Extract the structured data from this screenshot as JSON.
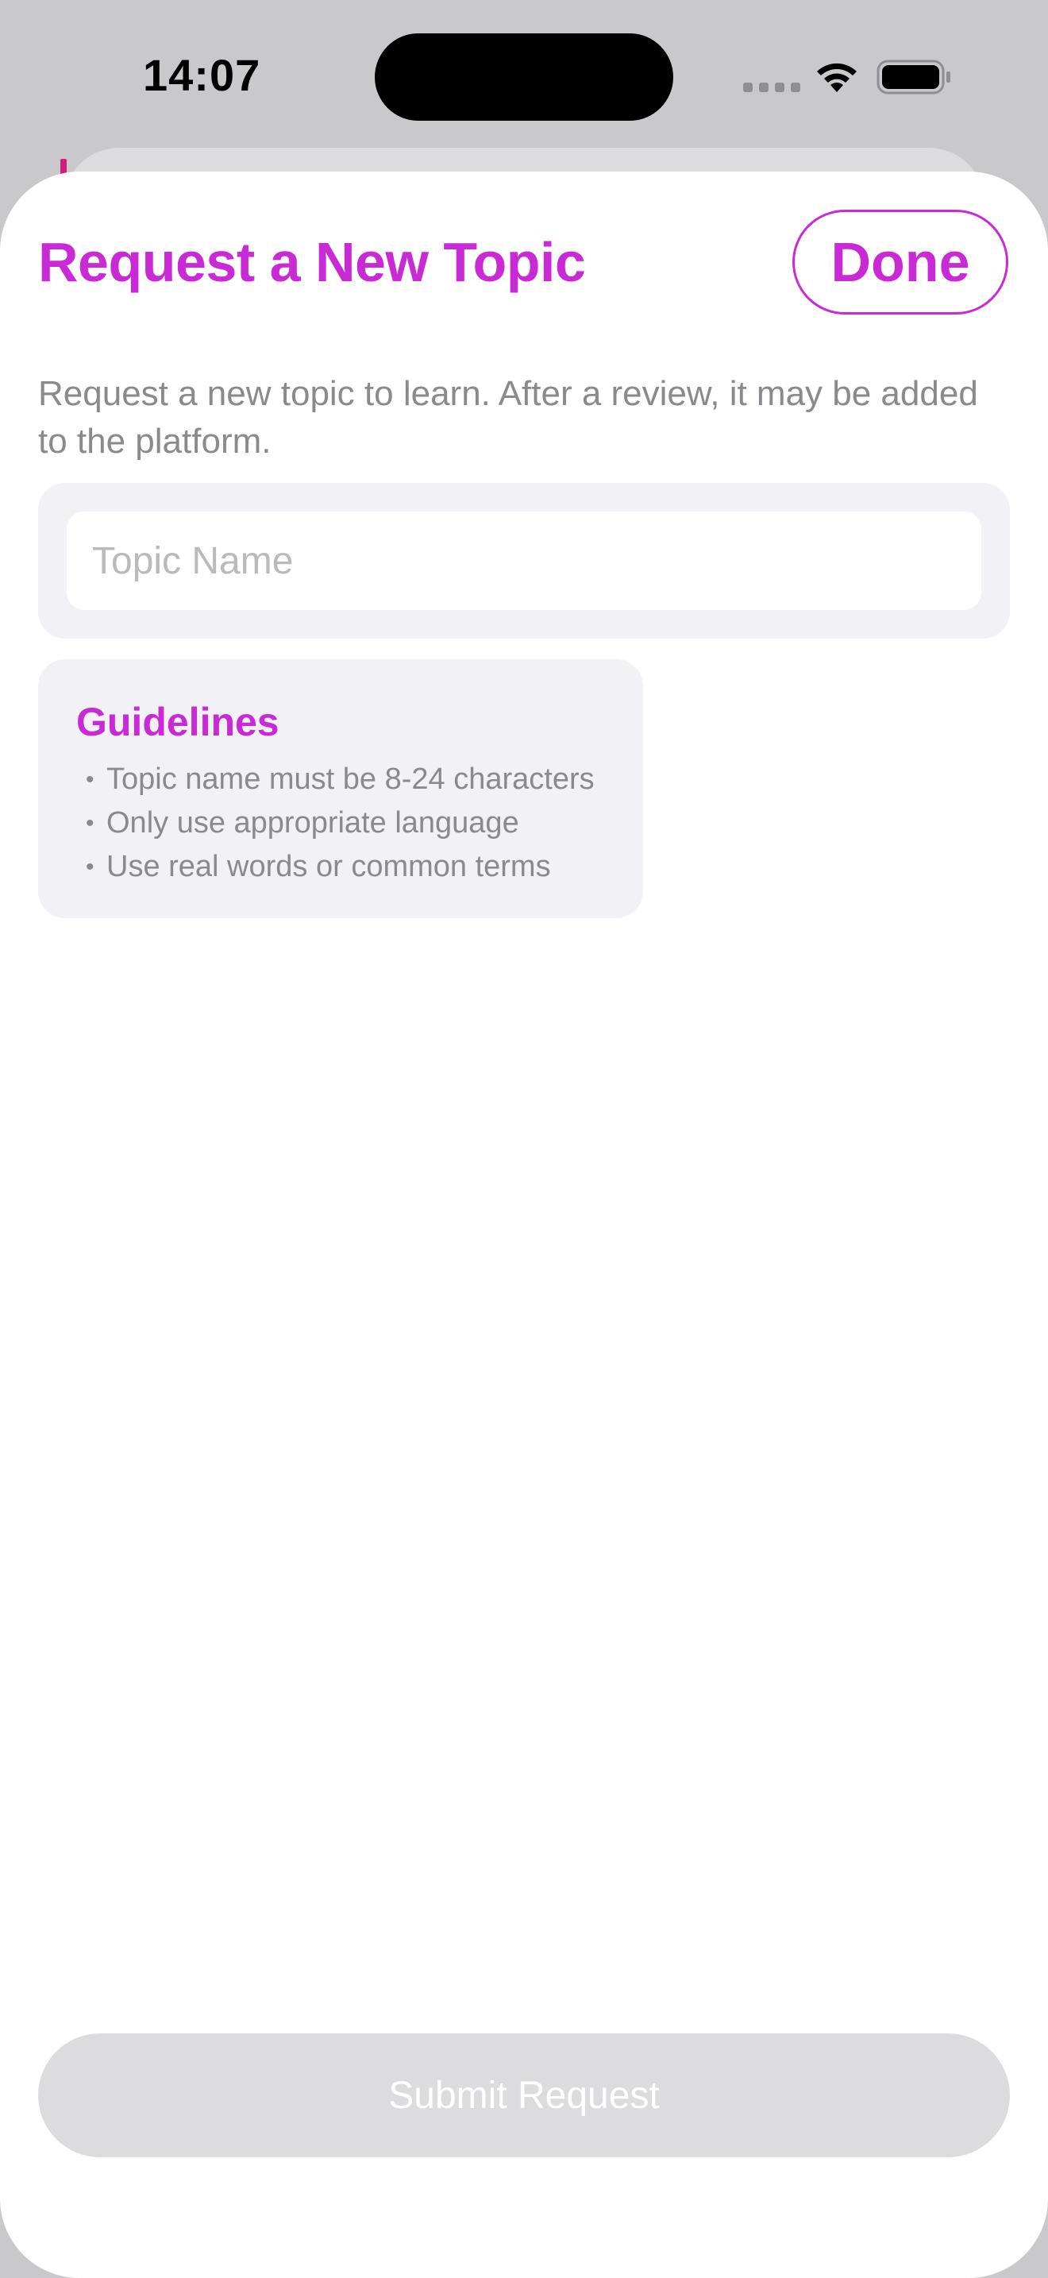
{
  "status_bar": {
    "time": "14:07",
    "icons": [
      "signal-dots-icon",
      "wifi-icon",
      "battery-icon"
    ]
  },
  "sheet": {
    "title": "Request a New Topic",
    "done_label": "Done",
    "description": "Request a new topic to learn. After a review, it may be added to the platform.",
    "topic_input": {
      "placeholder": "Topic Name",
      "value": ""
    },
    "guidelines": {
      "title": "Guidelines",
      "bullet": "•",
      "items": [
        "Topic name must be 8-24 characters",
        "Only use appropriate language",
        "Use real words or common terms"
      ]
    },
    "submit_label": "Submit Request",
    "submit_enabled": false
  },
  "colors": {
    "accent": "#c92ad6",
    "secondary_text": "#8a8a8e",
    "group_background": "#f1f1f6",
    "disabled_button": "#dcdcde",
    "backdrop": "#c9c9cb",
    "behind_accent": "#d01f7a"
  }
}
